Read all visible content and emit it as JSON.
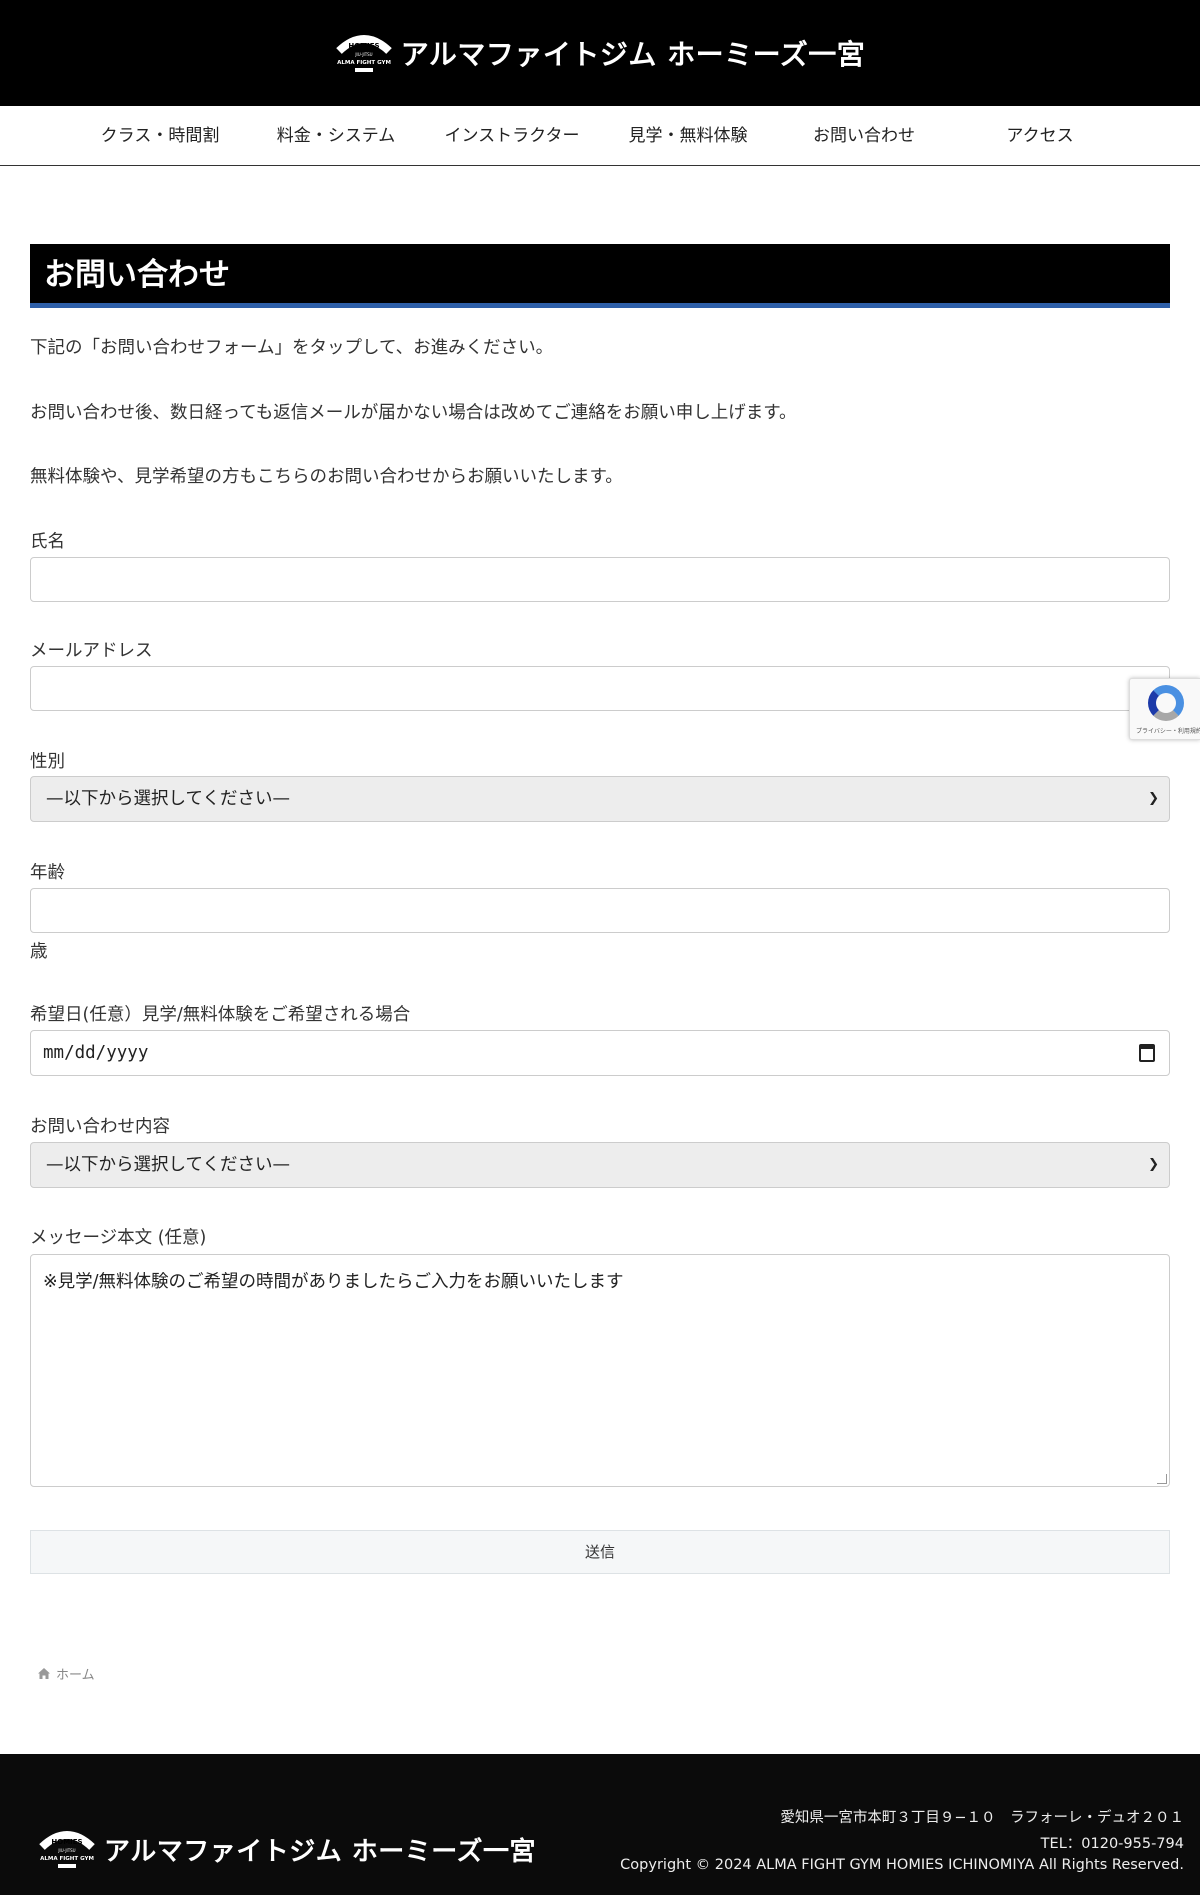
{
  "header": {
    "site_name": "アルマファイトジム ホーミーズ一宮",
    "emblem_text_top": "HOMIES",
    "emblem_text_mid": "JIU-JITSU",
    "emblem_text_bottom": "ALMA FIGHT GYM"
  },
  "nav": {
    "items": [
      {
        "label": "クラス・時間割"
      },
      {
        "label": "料金・システム"
      },
      {
        "label": "インストラクター"
      },
      {
        "label": "見学・無料体験"
      },
      {
        "label": "お問い合わせ"
      },
      {
        "label": "アクセス"
      }
    ]
  },
  "page": {
    "title": "お問い合わせ",
    "intro": [
      "下記の「お問い合わせフォーム」をタップして、お進みください。",
      "お問い合わせ後、数日経っても返信メールが届かない場合は改めてご連絡をお願い申し上げます。",
      "無料体験や、見学希望の方もこちらのお問い合わせからお願いいたします。"
    ]
  },
  "form": {
    "name_label": "氏名",
    "name_value": "",
    "email_label": "メールアドレス",
    "email_value": "",
    "gender_label": "性別",
    "gender_selected": "—以下から選択してください—",
    "age_label": "年齢",
    "age_value": "",
    "age_unit": "歳",
    "date_label": "希望日(任意）見学/無料体験をご希望される場合",
    "date_placeholder": "mm/dd/yyyy",
    "inquiry_label": "お問い合わせ内容",
    "inquiry_selected": "—以下から選択してください—",
    "message_label": "メッセージ本文 (任意)",
    "message_value": "※見学/無料体験のご希望の時間がありましたらご入力をお願いいたします",
    "submit_label": "送信"
  },
  "recaptcha": {
    "text": "プライバシー・利用規約"
  },
  "breadcrumb": {
    "home_label": "ホーム"
  },
  "footer": {
    "site_name": "アルマファイトジム ホーミーズ一宮",
    "address": "愛知県一宮市本町３丁目９−１０　ラフォーレ・デュオ２０１",
    "tel": "TEL：0120-955-794",
    "copyright": "Copyright © 2024 ALMA FIGHT GYM HOMIES ICHINOMIYA All Rights Reserved."
  },
  "colors": {
    "header_bg": "#000000",
    "title_accent": "#2e5fa8",
    "footer_bg": "#0b0b0b"
  }
}
